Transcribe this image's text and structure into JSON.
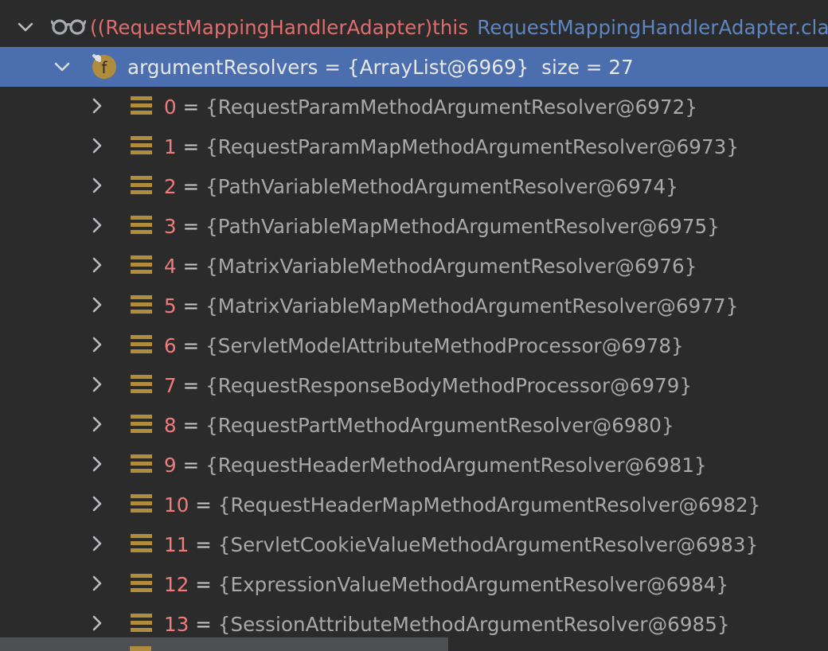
{
  "root": {
    "cast_text": "((RequestMappingHandlerAdapter)this",
    "class_text": "RequestMappingHandlerAdapter.cla",
    "icon": "watch-glasses-icon",
    "chevron": "chevron-down-icon"
  },
  "field": {
    "name": "argumentResolvers",
    "eq": " = ",
    "value": "{ArrayList@6969}",
    "size_text": "  size = 27",
    "icon": "field-f-icon",
    "chevron": "chevron-down-icon"
  },
  "items": [
    {
      "index": "0",
      "eq": " = ",
      "value": "{RequestParamMethodArgumentResolver@6972}"
    },
    {
      "index": "1",
      "eq": " = ",
      "value": "{RequestParamMapMethodArgumentResolver@6973}"
    },
    {
      "index": "2",
      "eq": " = ",
      "value": "{PathVariableMethodArgumentResolver@6974}"
    },
    {
      "index": "3",
      "eq": " = ",
      "value": "{PathVariableMapMethodArgumentResolver@6975}"
    },
    {
      "index": "4",
      "eq": " = ",
      "value": "{MatrixVariableMethodArgumentResolver@6976}"
    },
    {
      "index": "5",
      "eq": " = ",
      "value": "{MatrixVariableMapMethodArgumentResolver@6977}"
    },
    {
      "index": "6",
      "eq": " = ",
      "value": "{ServletModelAttributeMethodProcessor@6978}"
    },
    {
      "index": "7",
      "eq": " = ",
      "value": "{RequestResponseBodyMethodProcessor@6979}"
    },
    {
      "index": "8",
      "eq": " = ",
      "value": "{RequestPartMethodArgumentResolver@6980}"
    },
    {
      "index": "9",
      "eq": " = ",
      "value": "{RequestHeaderMethodArgumentResolver@6981}"
    },
    {
      "index": "10",
      "eq": " = ",
      "value": "{RequestHeaderMapMethodArgumentResolver@6982}"
    },
    {
      "index": "11",
      "eq": " = ",
      "value": "{ServletCookieValueMethodArgumentResolver@6983}"
    },
    {
      "index": "12",
      "eq": " = ",
      "value": "{ExpressionValueMethodArgumentResolver@6984}"
    },
    {
      "index": "13",
      "eq": " = ",
      "value": "{SessionAttributeMethodArgumentResolver@6985}"
    }
  ],
  "colors": {
    "background": "#2b2b2b",
    "selection": "#4b6eaf",
    "index": "#f07c7c",
    "object": "#a9a9a9",
    "icon_gold": "#b08d3c"
  }
}
